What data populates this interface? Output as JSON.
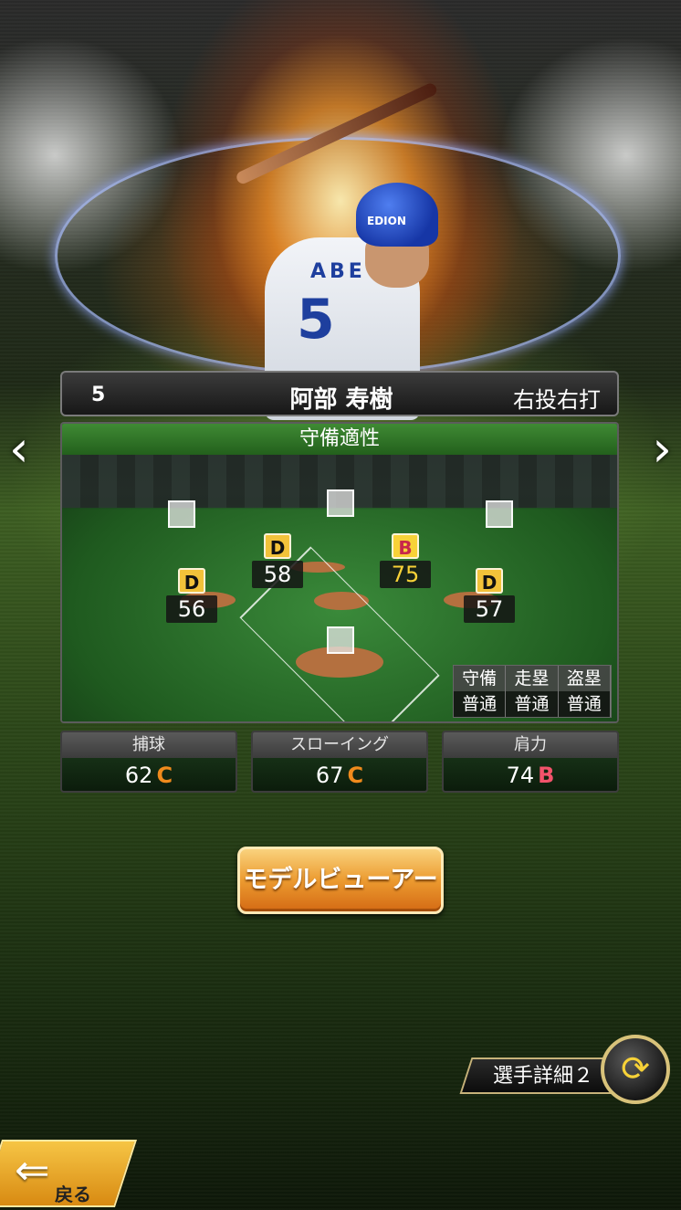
{
  "player": {
    "number": "5",
    "name": "阿部 寿樹",
    "throws_bats": "右投右打",
    "jersey_name": "ABE",
    "jersey_number": "5",
    "helmet_logo": "EDION"
  },
  "nav": {
    "prev": "‹",
    "next": "›"
  },
  "defense": {
    "title": "守備適性",
    "positions": [
      {
        "id": "first",
        "grade": "D",
        "value": "56"
      },
      {
        "id": "second",
        "grade": "D",
        "value": "58"
      },
      {
        "id": "short",
        "grade": "B",
        "value": "75"
      },
      {
        "id": "third",
        "grade": "D",
        "value": "57"
      }
    ],
    "abilities": {
      "headers": [
        "守備",
        "走塁",
        "盗塁"
      ],
      "values": [
        "普通",
        "普通",
        "普通"
      ]
    }
  },
  "stats": [
    {
      "label": "捕球",
      "value": "62",
      "grade": "C"
    },
    {
      "label": "スローイング",
      "value": "67",
      "grade": "C"
    },
    {
      "label": "肩力",
      "value": "74",
      "grade": "B"
    }
  ],
  "buttons": {
    "model_viewer": "モデルビューアー",
    "detail_toggle": "選手詳細２",
    "back": "戻る"
  },
  "colors": {
    "grade_B": "#f2536b",
    "grade_C": "#f08a1c",
    "accent_gold": "#f7d238"
  }
}
